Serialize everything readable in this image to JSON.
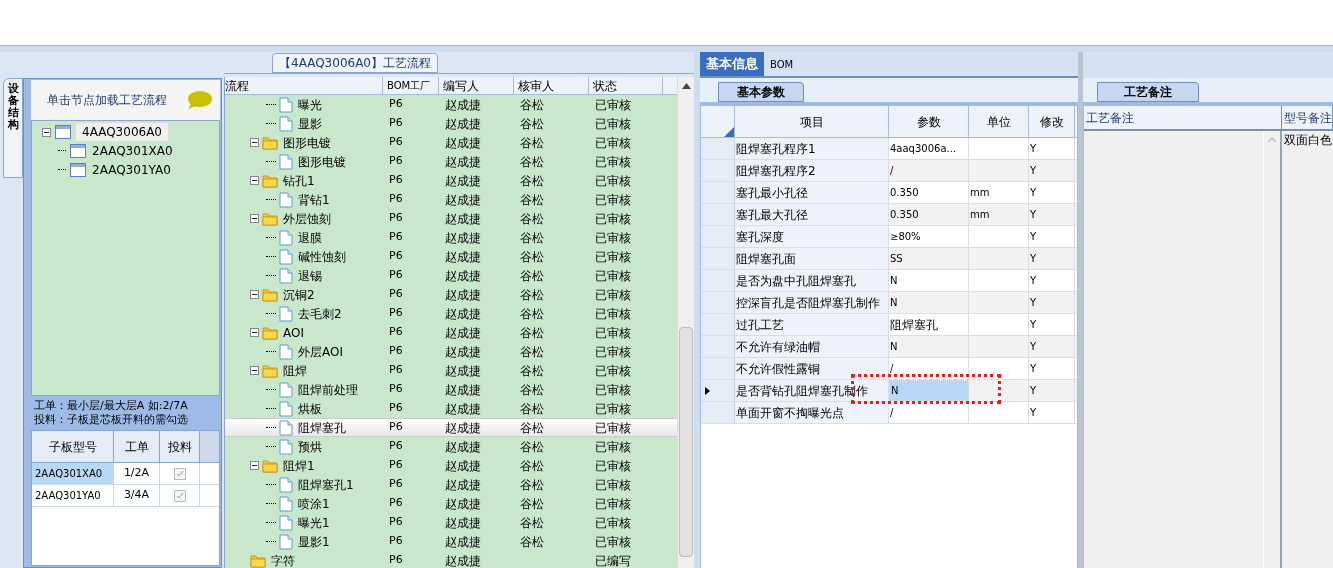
{
  "left_panel": {
    "side_tab": "设备结构",
    "header": "单击节点加载工艺流程",
    "tree": [
      {
        "label": "4AAQ3006A0",
        "expanded": true,
        "selected": true,
        "children": [
          {
            "label": "2AAQ301XA0",
            "selected": false
          },
          {
            "label": "2AAQ301YA0",
            "selected": false
          }
        ]
      }
    ],
    "note_lines": [
      "工单：最小层/最大层A 如:2/7A",
      "投料：子板是芯板开料的需勾选"
    ],
    "table": {
      "columns": [
        "子板型号",
        "工单",
        "投料"
      ],
      "rows": [
        {
          "cells": [
            "2AAQ301XA0",
            "1/2A"
          ],
          "checked": true,
          "selected": true
        },
        {
          "cells": [
            "2AAQ301YA0",
            "3/4A"
          ],
          "checked": true,
          "selected": false
        }
      ]
    }
  },
  "flow_panel": {
    "title": "【4AAQ3006A0】工艺流程",
    "columns": [
      "流程",
      "BOM工厂",
      "编写人",
      "核审人",
      "状态"
    ],
    "rows": [
      {
        "children": [
          {
            "label": "曝光",
            "cells": [
              "P6",
              "赵成捷",
              "谷松",
              "已审核"
            ],
            "selected": false
          },
          {
            "label": "显影",
            "cells": [
              "P6",
              "赵成捷",
              "谷松",
              "已审核"
            ],
            "selected": false
          }
        ]
      },
      {
        "label": "图形电镀",
        "cells": [
          "P6",
          "赵成捷",
          "谷松",
          "已审核"
        ],
        "selected": false,
        "children": [
          {
            "label": "图形电镀",
            "cells": [
              "P6",
              "赵成捷",
              "谷松",
              "已审核"
            ],
            "selected": false
          }
        ]
      },
      {
        "label": "钻孔1",
        "cells": [
          "P6",
          "赵成捷",
          "谷松",
          "已审核"
        ],
        "selected": false,
        "children": [
          {
            "label": "背钻1",
            "cells": [
              "P6",
              "赵成捷",
              "谷松",
              "已审核"
            ],
            "selected": false
          }
        ]
      },
      {
        "label": "外层蚀刻",
        "cells": [
          "P6",
          "赵成捷",
          "谷松",
          "已审核"
        ],
        "selected": false,
        "children": [
          {
            "label": "退膜",
            "cells": [
              "P6",
              "赵成捷",
              "谷松",
              "已审核"
            ],
            "selected": false
          },
          {
            "label": "碱性蚀刻",
            "cells": [
              "P6",
              "赵成捷",
              "谷松",
              "已审核"
            ],
            "selected": false
          },
          {
            "label": "退锡",
            "cells": [
              "P6",
              "赵成捷",
              "谷松",
              "已审核"
            ],
            "selected": false
          }
        ]
      },
      {
        "label": "沉铜2",
        "cells": [
          "P6",
          "赵成捷",
          "谷松",
          "已审核"
        ],
        "selected": false,
        "children": [
          {
            "label": "去毛刺2",
            "cells": [
              "P6",
              "赵成捷",
              "谷松",
              "已审核"
            ],
            "selected": false
          }
        ]
      },
      {
        "label": "AOI",
        "cells": [
          "P6",
          "赵成捷",
          "谷松",
          "已审核"
        ],
        "selected": false,
        "children": [
          {
            "label": "外层AOI",
            "cells": [
              "P6",
              "赵成捷",
              "谷松",
              "已审核"
            ],
            "selected": false
          }
        ]
      },
      {
        "label": "阻焊",
        "cells": [
          "P6",
          "赵成捷",
          "谷松",
          "已审核"
        ],
        "selected": false,
        "children": [
          {
            "label": "阻焊前处理",
            "cells": [
              "P6",
              "赵成捷",
              "谷松",
              "已审核"
            ],
            "selected": false
          },
          {
            "label": "烘板",
            "cells": [
              "P6",
              "赵成捷",
              "谷松",
              "已审核"
            ],
            "selected": false
          },
          {
            "label": "阻焊塞孔",
            "cells": [
              "P6",
              "赵成捷",
              "谷松",
              "已审核"
            ],
            "selected": true
          },
          {
            "label": "预烘",
            "cells": [
              "P6",
              "赵成捷",
              "谷松",
              "已审核"
            ],
            "selected": false
          }
        ]
      },
      {
        "label": "阻焊1",
        "cells": [
          "P6",
          "赵成捷",
          "谷松",
          "已审核"
        ],
        "selected": false,
        "children": [
          {
            "label": "阻焊塞孔1",
            "cells": [
              "P6",
              "赵成捷",
              "谷松",
              "已审核"
            ],
            "selected": false
          },
          {
            "label": "喷涂1",
            "cells": [
              "P6",
              "赵成捷",
              "谷松",
              "已审核"
            ],
            "selected": false
          },
          {
            "label": "曝光1",
            "cells": [
              "P6",
              "赵成捷",
              "谷松",
              "已审核"
            ],
            "selected": false
          },
          {
            "label": "显影1",
            "cells": [
              "P6",
              "赵成捷",
              "谷松",
              "已审核"
            ],
            "selected": false
          }
        ]
      },
      {
        "label": "字符",
        "cells": [
          "P6",
          "赵成捷",
          "",
          "已编写"
        ],
        "selected": false
      }
    ]
  },
  "info_panel": {
    "tabs": [
      {
        "label": "基本信息",
        "selected": true
      },
      {
        "label": "BOM",
        "selected": false
      }
    ],
    "sub_tab": "基本参数",
    "columns": [
      "项目",
      "参数",
      "单位",
      "修改"
    ],
    "rows": [
      {
        "cells": [
          "阻焊塞孔程序1",
          "4aaq3006a...",
          "",
          "Y"
        ],
        "selected": false
      },
      {
        "cells": [
          "阻焊塞孔程序2",
          "/",
          "",
          "Y"
        ],
        "selected": false
      },
      {
        "cells": [
          "塞孔最小孔径",
          "0.350",
          "mm",
          "Y"
        ],
        "selected": false
      },
      {
        "cells": [
          "塞孔最大孔径",
          "0.350",
          "mm",
          "Y"
        ],
        "selected": false
      },
      {
        "cells": [
          "塞孔深度",
          "≥80%",
          "",
          "Y"
        ],
        "selected": false
      },
      {
        "cells": [
          "阻焊塞孔面",
          "SS",
          "",
          "Y"
        ],
        "selected": false
      },
      {
        "cells": [
          "是否为盘中孔阻焊塞孔",
          "N",
          "",
          "Y"
        ],
        "selected": false
      },
      {
        "cells": [
          "控深盲孔是否阻焊塞孔制作",
          "N",
          "",
          "Y"
        ],
        "selected": false
      },
      {
        "cells": [
          "过孔工艺",
          "阻焊塞孔",
          "",
          "Y"
        ],
        "selected": false
      },
      {
        "cells": [
          "不允许有绿油帽",
          "N",
          "",
          "Y"
        ],
        "selected": false
      },
      {
        "cells": [
          "不允许假性露铜",
          "/",
          "",
          "Y"
        ],
        "selected": false
      },
      {
        "cells": [
          "是否背钻孔阻焊塞孔制作",
          "N",
          "",
          "Y"
        ],
        "selected": true
      },
      {
        "cells": [
          "单面开窗不掏曝光点",
          "/",
          "",
          "Y"
        ],
        "selected": false
      }
    ]
  },
  "notes_panel": {
    "tab": "工艺备注",
    "columns": [
      "工艺备注",
      "型号备注"
    ],
    "model_note": "双面白色"
  }
}
